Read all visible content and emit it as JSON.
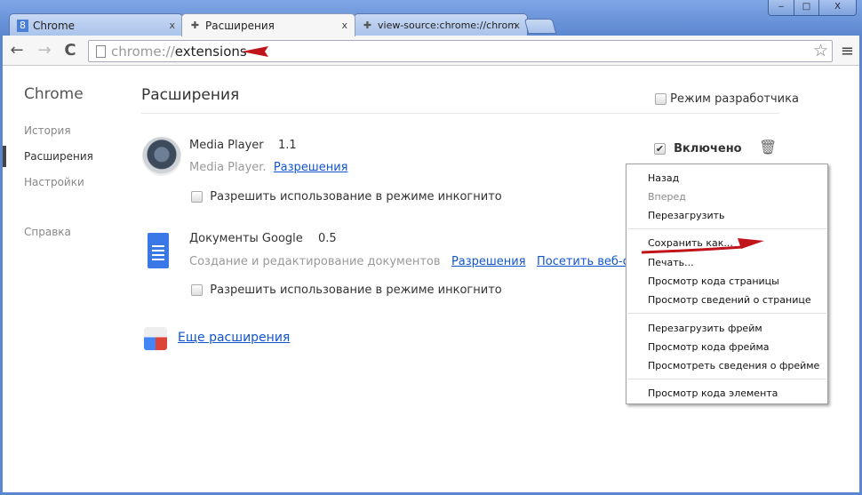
{
  "window": {
    "minimize": "‒",
    "maximize": "□",
    "close": "X"
  },
  "tabs": [
    {
      "label": "Chrome",
      "icon": "google-icon",
      "active": false
    },
    {
      "label": "Расширения",
      "icon": "puzzle-icon",
      "active": true
    },
    {
      "label": "view-source:chrome://chrom",
      "icon": "puzzle-icon",
      "active": false
    }
  ],
  "toolbar": {
    "url_scheme": "chrome://",
    "url_host": "extensions"
  },
  "sidebar": {
    "title": "Chrome",
    "items": [
      {
        "label": "История"
      },
      {
        "label": "Расширения",
        "selected": true
      },
      {
        "label": "Настройки"
      },
      {
        "label": "Справка"
      }
    ]
  },
  "main": {
    "title": "Расширения",
    "dev_mode": "Режим разработчика",
    "extensions": [
      {
        "name": "Media Player",
        "version": "1.1",
        "description": "Media Player.",
        "links": [
          "Разрешения"
        ],
        "incognito": "Разрешить использование в режиме инкогнито",
        "enabled_label": "Включено",
        "enabled": true
      },
      {
        "name": "Документы Google",
        "version": "0.5",
        "description": "Создание и редактирование документов",
        "links": [
          "Разрешения",
          "Посетить веб-сайт"
        ],
        "incognito": "Разрешить использование в режиме инкогнито"
      }
    ],
    "more": "Еще расширения"
  },
  "context_menu": {
    "items": [
      {
        "label": "Назад"
      },
      {
        "label": "Вперед",
        "disabled": true
      },
      {
        "label": "Перезагрузить"
      },
      {
        "label": "Сохранить как..."
      },
      {
        "label": "Печать..."
      },
      {
        "label": "Просмотр кода страницы"
      },
      {
        "label": "Просмотр  сведений о странице"
      },
      {
        "label": "Перезагрузить фрейм"
      },
      {
        "label": "Просмотр кода фрейма"
      },
      {
        "label": "Просмотреть сведения о фрейме"
      },
      {
        "label": "Просмотр кода элемента"
      }
    ]
  },
  "colors": {
    "annotation_arrow": "#c0141a",
    "link": "#1155cc",
    "frame": "#5f8bd3"
  }
}
